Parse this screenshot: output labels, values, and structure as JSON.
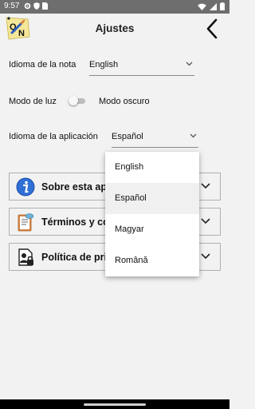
{
  "status_bar": {
    "time": "9:57",
    "left_icons": [
      "settings-icon",
      "shield-icon",
      "sim-card-icon"
    ],
    "right_icons": [
      "wifi-icon",
      "cell-signal-icon",
      "battery-icon"
    ]
  },
  "header": {
    "title": "Ajustes",
    "logo": "note-app-logo",
    "back_icon": "chevron-left-icon"
  },
  "settings": {
    "note_language_label": "Idioma de la nota",
    "note_language_value": "English",
    "light_mode_label": "Modo de luz",
    "dark_mode_label": "Modo oscuro",
    "dark_mode_on": false,
    "app_language_label": "Idioma de la aplicación",
    "app_language_value": "Español"
  },
  "cards": [
    {
      "label": "Sobre esta apl",
      "icon": "info-icon"
    },
    {
      "label": "Términos y co",
      "icon": "document-icon"
    },
    {
      "label": "Política de priv",
      "icon": "privacy-icon"
    }
  ],
  "dropdown": {
    "options": [
      "English",
      "Español",
      "Magyar",
      "Română"
    ],
    "selected": "Español"
  },
  "colors": {
    "background": "#f2f2f2",
    "status_bar": "#6e6e6e",
    "info_blue": "#2f6fd6"
  }
}
